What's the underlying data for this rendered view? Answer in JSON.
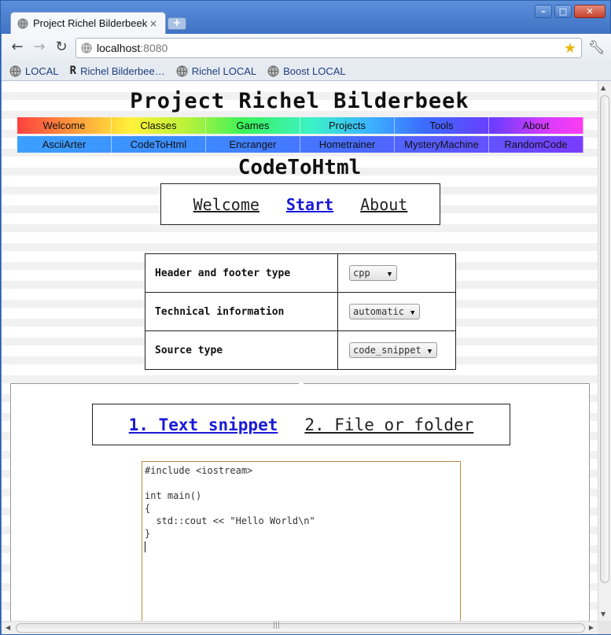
{
  "browser": {
    "tab_title": "Project Richel Bilderbeek",
    "tab_close": "×",
    "new_tab": "+",
    "window_buttons": [
      "–",
      "□",
      "✕"
    ],
    "url_host": "localhost",
    "url_port": ":8080",
    "bookmarks": [
      {
        "label": "LOCAL",
        "icon": "globe-icon"
      },
      {
        "label": "Richel Bilderbee…",
        "icon": "r-logo-icon"
      },
      {
        "label": "Richel LOCAL",
        "icon": "globe-icon"
      },
      {
        "label": "Boost LOCAL",
        "icon": "globe-icon"
      }
    ]
  },
  "page": {
    "site_title": "Project Richel Bilderbeek",
    "menu_row1": [
      "Welcome",
      "Classes",
      "Games",
      "Projects",
      "Tools",
      "About"
    ],
    "menu_row2": [
      "AsciiArter",
      "CodeToHtml",
      "Encranger",
      "Hometrainer",
      "MysteryMachine",
      "RandomCode"
    ],
    "heading": "CodeToHtml",
    "subnav": {
      "welcome": "Welcome",
      "start": "Start",
      "about": "About",
      "active": "Start"
    },
    "options": [
      {
        "label": "Header and footer type",
        "value": "cpp"
      },
      {
        "label": "Technical information",
        "value": "automatic"
      },
      {
        "label": "Source type",
        "value": "code_snippet"
      }
    ],
    "modes": {
      "text_snippet": "1. Text snippet",
      "file_or_folder": "2. File or folder",
      "active": "1. Text snippet"
    },
    "code_text": "#include <iostream>\n\nint main()\n{\n  std::cout << \"Hello World\\n\"\n}\n"
  },
  "colors": {
    "accent_link": "#1a1ad8",
    "titlebar": "#4a7fd0",
    "textarea_border": "#b88a3a"
  }
}
